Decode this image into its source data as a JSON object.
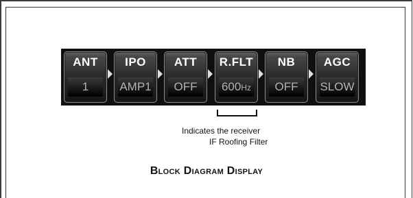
{
  "blocks": [
    {
      "label": "ANT",
      "value": "1",
      "unit": ""
    },
    {
      "label": "IPO",
      "value": "AMP1",
      "unit": ""
    },
    {
      "label": "ATT",
      "value": "OFF",
      "unit": ""
    },
    {
      "label": "R.FLT",
      "value": "600",
      "unit": "Hz"
    },
    {
      "label": "NB",
      "value": "OFF",
      "unit": ""
    },
    {
      "label": "AGC",
      "value": "SLOW",
      "unit": ""
    }
  ],
  "annotation": {
    "line1": "Indicates the receiver",
    "line2": "IF Roofing Filter"
  },
  "caption": "Block Diagram Display",
  "colors": {
    "strip_background": "#101010",
    "label_text": "#ffffff",
    "value_text": "#b4b4b4",
    "arrow": "#dedede"
  }
}
